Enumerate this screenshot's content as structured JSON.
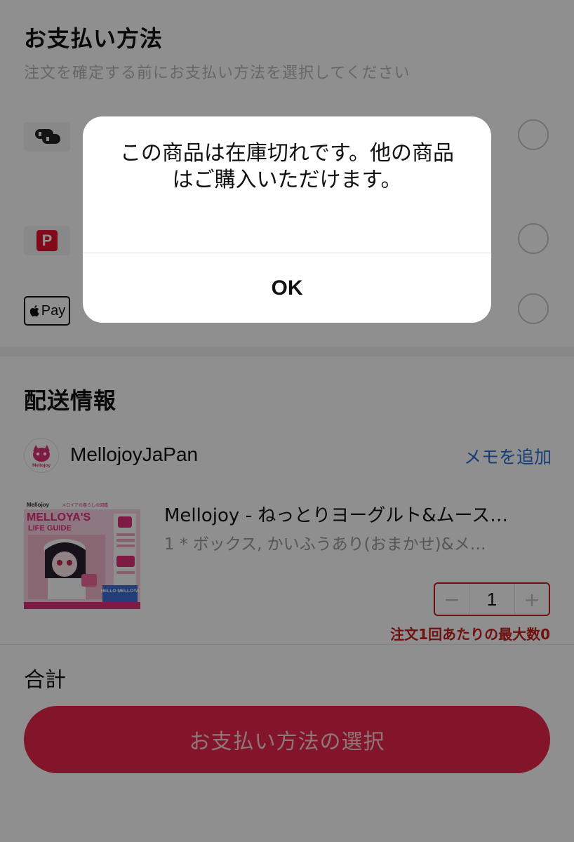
{
  "payment": {
    "title": "お支払い方法",
    "subtitle": "注文を確定する前にお支払い方法を選択してください",
    "options": [
      {
        "icon": "merpay-icon"
      },
      {
        "icon": "paypay-icon",
        "mark": "P"
      },
      {
        "icon": "apple-pay-icon",
        "mark": "Pay"
      }
    ]
  },
  "shipping": {
    "title": "配送情報",
    "store_name": "MellojoyJaPan",
    "avatar_text": "Mellojoy",
    "memo_link": "メモを追加"
  },
  "product": {
    "title": "Mellojoy - ねっとりヨーグルト&ムース…",
    "variant": "1 * ボックス, かいふうあり(おまかせ)&メ…",
    "quantity": "1",
    "minus": "−",
    "plus": "+",
    "max_note": "注文1回あたりの最大数0",
    "thumb": {
      "brand": "Mellojoy",
      "tagline": "メロイアの暮らしの図鑑",
      "headline_1": "MELLOYA'S",
      "headline_2": "LIFE GUIDE",
      "hello": "HELLO MELLOYA"
    }
  },
  "total": {
    "label": "合計"
  },
  "cta": {
    "label": "お支払い方法の選択"
  },
  "alert": {
    "message": "この商品は在庫切れです。他の商品はご購入いただけます。",
    "ok": "OK"
  },
  "colors": {
    "accent": "#e8264a",
    "link": "#2a6fd6",
    "error": "#c81e1e",
    "overlay": "rgba(0,0,0,0.44)"
  }
}
